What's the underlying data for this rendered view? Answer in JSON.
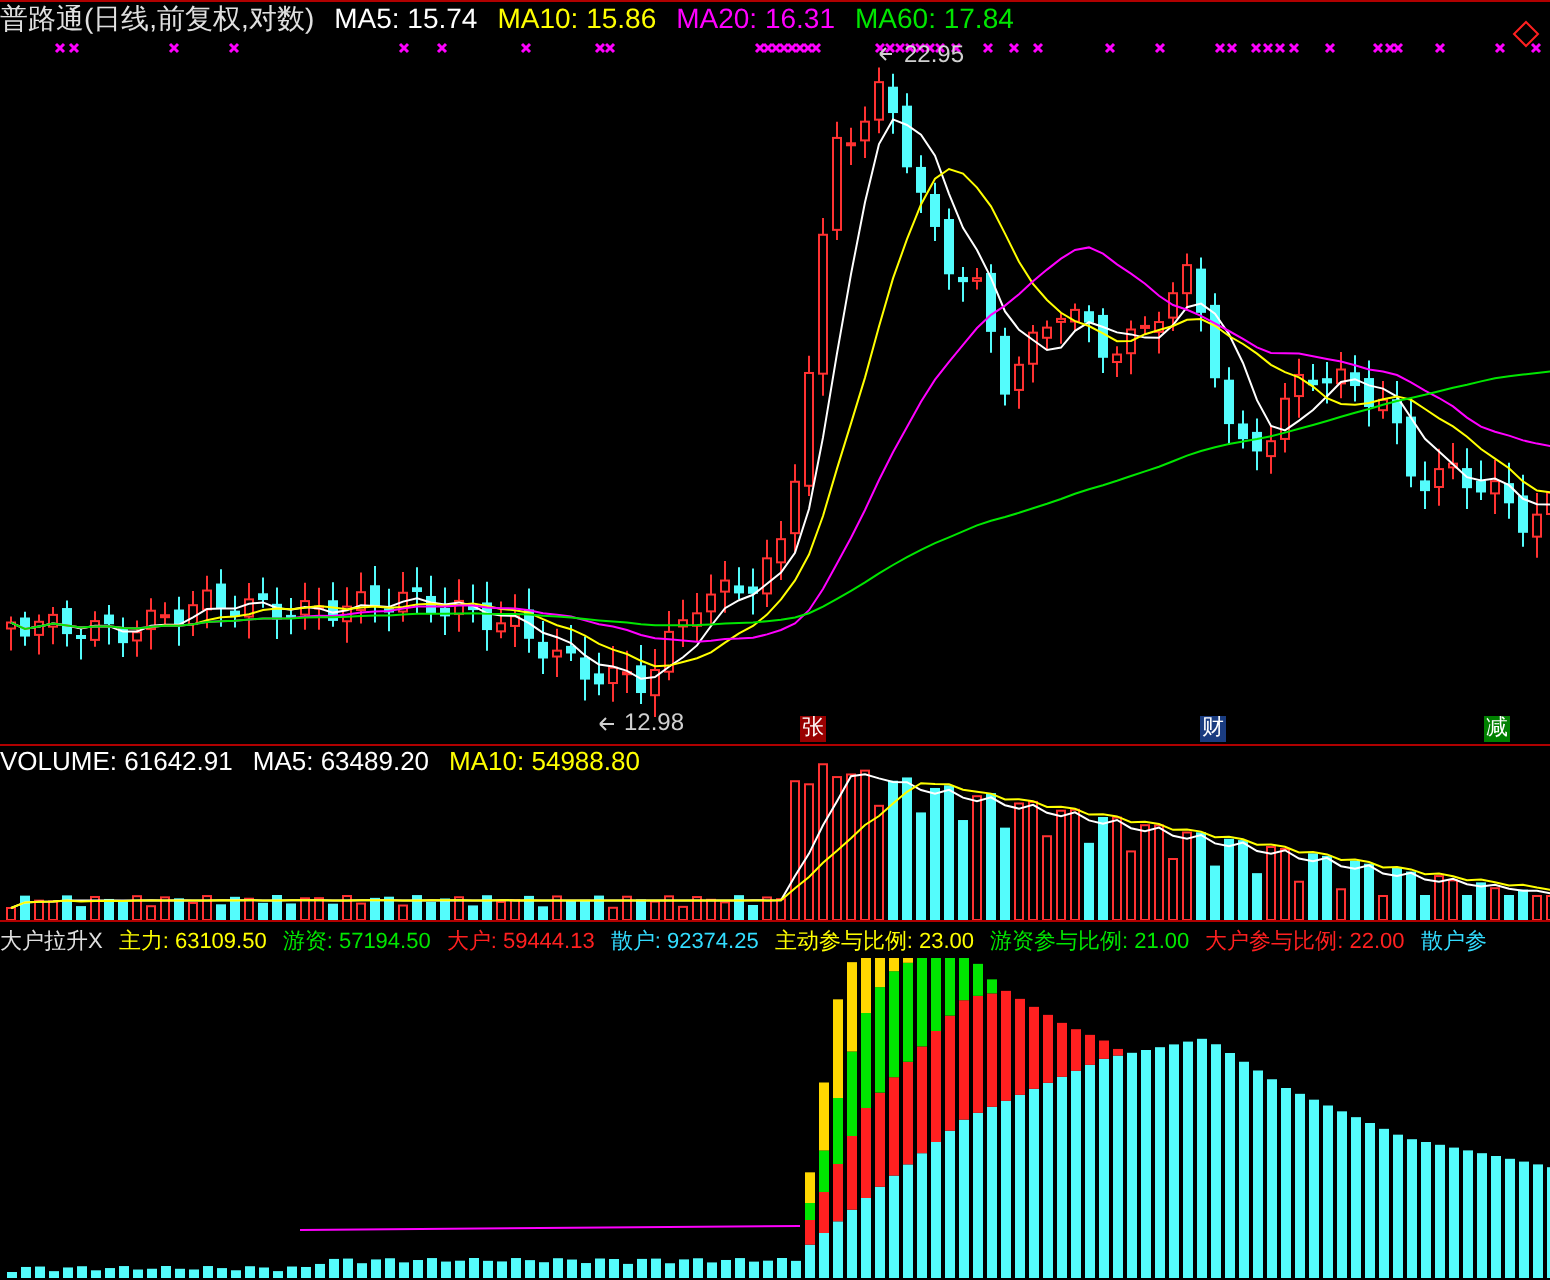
{
  "price_panel": {
    "title": "普路通(日线,前复权,对数)",
    "indicators": [
      {
        "label": "MA5: 15.74",
        "color": "#ffffff"
      },
      {
        "label": "MA10: 15.86",
        "color": "#ffff00"
      },
      {
        "label": "MA20: 16.31",
        "color": "#ff00ff"
      },
      {
        "label": "MA60: 17.84",
        "color": "#00e600"
      }
    ],
    "high_label": "22.95",
    "low_label": "12.98",
    "event_badges": [
      {
        "text": "张",
        "color": "#990000"
      },
      {
        "text": "财",
        "color": "#1a3c80"
      },
      {
        "text": "减",
        "color": "#008000"
      }
    ]
  },
  "volume_panel": {
    "indicators": [
      {
        "label": "VOLUME: 61642.91",
        "color": "#ffffff"
      },
      {
        "label": "MA5: 63489.20",
        "color": "#ffffff"
      },
      {
        "label": "MA10: 54988.80",
        "color": "#ffff00"
      }
    ]
  },
  "money_panel": {
    "name": "大户拉升X",
    "indicators": [
      {
        "label": "主力:",
        "value": "63109.50",
        "color": "#ffff00"
      },
      {
        "label": "游资:",
        "value": "57194.50",
        "color": "#00e600"
      },
      {
        "label": "大户:",
        "value": "59444.13",
        "color": "#ff2020"
      },
      {
        "label": "散户:",
        "value": "92374.25",
        "color": "#33ddff"
      },
      {
        "label": "主动参与比例:",
        "value": "23.00",
        "color": "#ffff00"
      },
      {
        "label": "游资参与比例:",
        "value": "21.00",
        "color": "#00e600"
      },
      {
        "label": "大户参与比例:",
        "value": "22.00",
        "color": "#ff2020"
      },
      {
        "label": "散户参",
        "color": "#33ddff"
      }
    ]
  }
}
